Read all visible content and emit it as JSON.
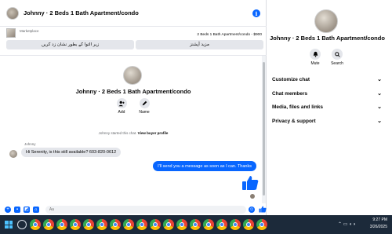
{
  "chat": {
    "header_title": "Johnny · 2 Beds 1 Bath Apartment/condo",
    "marketplace_label": "Marketplace",
    "listing": "2 Beds 1 Bath Apartment/condo - $900",
    "btn_mark": "زیر التوا کے بطور نشان زد کریں",
    "btn_more": "مزید آپشنز",
    "profile_name": "Johnny · 2 Beds 1 Bath Apartment/condo",
    "add_label": "Add",
    "name_label": "Name",
    "started_text": "Johnny started this chat.",
    "view_profile": "View buyer profile",
    "sender_name": "Johnny",
    "msg_in": "Hi Serenity, is this still available? 603-820-0612",
    "msg_out": "I'll send you a message as soon as I can. Thanks",
    "input_placeholder": "Aa"
  },
  "panel": {
    "name": "Johnny · 2 Beds 1 Bath Apartment/condo",
    "mute_label": "Mute",
    "search_label": "Search",
    "items": [
      {
        "label": "Customize chat"
      },
      {
        "label": "Chat members"
      },
      {
        "label": "Media, files and links"
      },
      {
        "label": "Privacy & support"
      }
    ]
  },
  "taskbar": {
    "time": "9:27 PM",
    "date": "3/26/2025",
    "colors": {
      "bg": "#1c2a3a",
      "start": "#4cc2ff"
    }
  },
  "colors": {
    "accent": "#0866ff",
    "bubble_in": "#e4e6eb"
  }
}
